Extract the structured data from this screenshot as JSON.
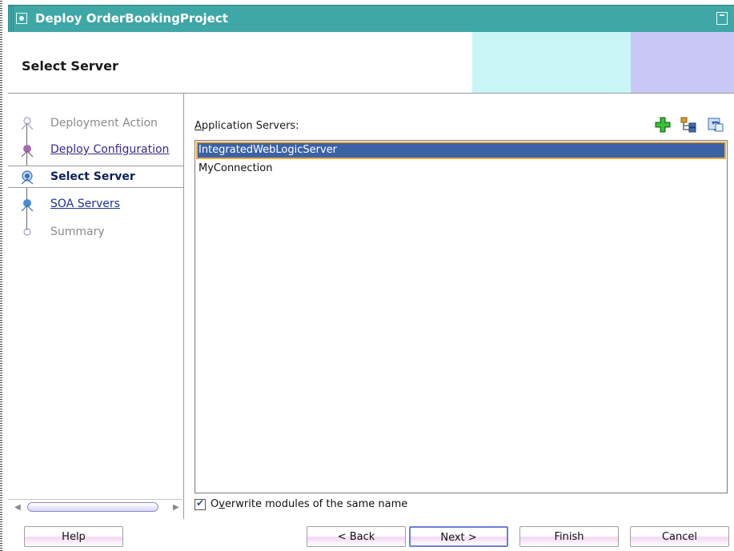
{
  "window": {
    "title": "Deploy OrderBookingProject"
  },
  "header": {
    "title": "Select Server"
  },
  "nav": {
    "steps": [
      {
        "label": "Deployment Action",
        "state": "done"
      },
      {
        "label": "Deploy Configuration",
        "state": "link"
      },
      {
        "label": "Select Server",
        "state": "current"
      },
      {
        "label": "SOA Servers",
        "state": "link"
      },
      {
        "label": "Summary",
        "state": "todo"
      }
    ]
  },
  "main": {
    "servers_label": "Application Servers:",
    "servers_label_mnemonic": "A",
    "servers_label_rest": "pplication Servers:",
    "servers": [
      {
        "name": "IntegratedWebLogicServer",
        "selected": true
      },
      {
        "name": "MyConnection",
        "selected": false
      }
    ],
    "toolbar_icons": [
      "add-icon",
      "hierarchy-icon",
      "refresh-icon"
    ],
    "overwrite": {
      "label_pre": "O",
      "label_mnemonic": "v",
      "label_post": "erwrite modules of the same name",
      "checked": true
    }
  },
  "footer": {
    "help": "Help",
    "back": "< Back",
    "next": "Next >",
    "finish": "Finish",
    "cancel": "Cancel"
  },
  "colors": {
    "titlebar": "#3fa7a5",
    "selection": "#3a62a4",
    "selection_outline": "#f0a83a",
    "header_band1": "#c9f5f7",
    "header_band2": "#c9c7f5"
  }
}
